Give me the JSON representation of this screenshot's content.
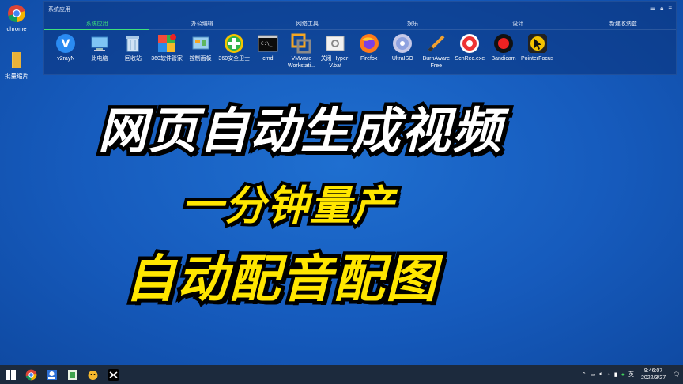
{
  "desktop": {
    "icons": [
      {
        "label": "chrome",
        "icon": "chrome-icon"
      },
      {
        "label": "批量缩片",
        "icon": "folder-icon"
      }
    ]
  },
  "fence": {
    "title": "系统应用",
    "tabs": [
      "系统应用",
      "办公编辑",
      "网络工具",
      "娱乐",
      "设计",
      "新建收纳盒"
    ],
    "active_tab": 0,
    "apps": [
      {
        "label": "v2rayN",
        "icon": "v2rayn-icon"
      },
      {
        "label": "此电脑",
        "icon": "computer-icon"
      },
      {
        "label": "回收站",
        "icon": "recycle-bin-icon"
      },
      {
        "label": "360软件管家",
        "icon": "360-software-manager-icon"
      },
      {
        "label": "控制面板",
        "icon": "control-panel-icon"
      },
      {
        "label": "360安全卫士",
        "icon": "360-security-icon"
      },
      {
        "label": "cmd",
        "icon": "cmd-icon"
      },
      {
        "label": "VMware Workstati...",
        "icon": "vmware-icon"
      },
      {
        "label": "关闭 Hyper-V.bat",
        "icon": "bat-file-icon"
      },
      {
        "label": "Firefox",
        "icon": "firefox-icon"
      },
      {
        "label": "UltraISO",
        "icon": "ultraiso-icon"
      },
      {
        "label": "BurnAware Free",
        "icon": "burnaware-icon"
      },
      {
        "label": "ScnRec.exe",
        "icon": "scnrec-icon"
      },
      {
        "label": "Bandicam",
        "icon": "bandicam-icon"
      },
      {
        "label": "PointerFocus",
        "icon": "pointerfocus-icon"
      }
    ]
  },
  "headline": {
    "line1": "网页自动生成视频",
    "line2": "一分钟量产",
    "line3": "自动配音配图"
  },
  "taskbar": {
    "ime": "英",
    "time": "9:46:07",
    "date": "2022/3/27"
  },
  "colors": {
    "desktop_bg": "#1557b8",
    "active_tab": "#3fe07a",
    "headline_yellow": "#ffe600",
    "taskbar_bg": "#1c2a3d"
  }
}
